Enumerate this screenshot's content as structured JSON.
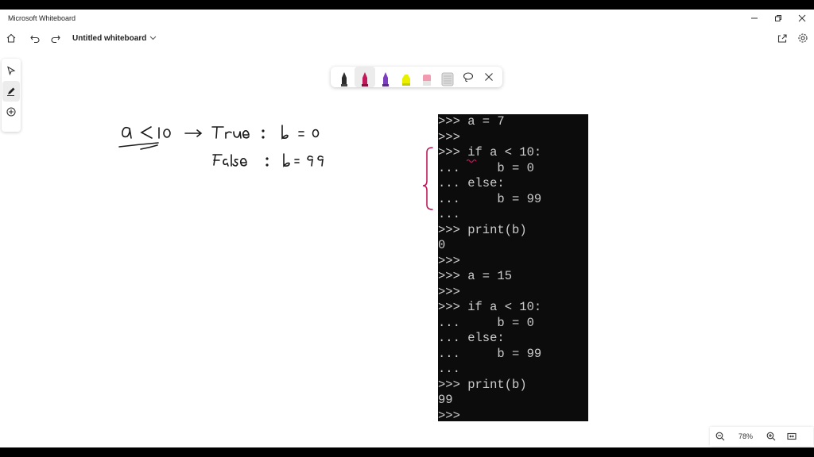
{
  "app": {
    "title": "Microsoft Whiteboard",
    "board_title": "Untitled whiteboard"
  },
  "window_controls": [
    "minimize",
    "restore",
    "close"
  ],
  "toolbar_icons": [
    "home-icon",
    "undo-icon",
    "redo-icon",
    "share-icon",
    "settings-icon"
  ],
  "left_tools": [
    "select-icon",
    "pen-icon",
    "add-icon"
  ],
  "ink_tray": {
    "pens": [
      {
        "name": "black",
        "color": "#2b2b2b"
      },
      {
        "name": "magenta",
        "color": "#c2185b"
      },
      {
        "name": "purple",
        "color": "#7b3fbf"
      },
      {
        "name": "highlighter-yellow",
        "color": "#e8f000"
      },
      {
        "name": "eraser",
        "color": "#f29ab0"
      },
      {
        "name": "ruler",
        "color": "#cfcfcf"
      }
    ],
    "selected_pen": "magenta"
  },
  "handwriting": {
    "line1": "a < 10 → True : b = 0",
    "line2": "False : b = 99",
    "ink_color": "#1a1a1a",
    "bracket_color": "#c2185b"
  },
  "terminal": {
    "lines": [
      ">>> a = 7",
      ">>>",
      ">>> if a < 10:",
      "...     b = 0",
      "... else:",
      "...     b = 99",
      "...",
      ">>> print(b)",
      "0",
      ">>>",
      ">>> a = 15",
      ">>>",
      ">>> if a < 10:",
      "...     b = 0",
      "... else:",
      "...     b = 99",
      "...",
      ">>> print(b)",
      "99",
      ">>>"
    ]
  },
  "zoom": {
    "level_label": "78%"
  }
}
